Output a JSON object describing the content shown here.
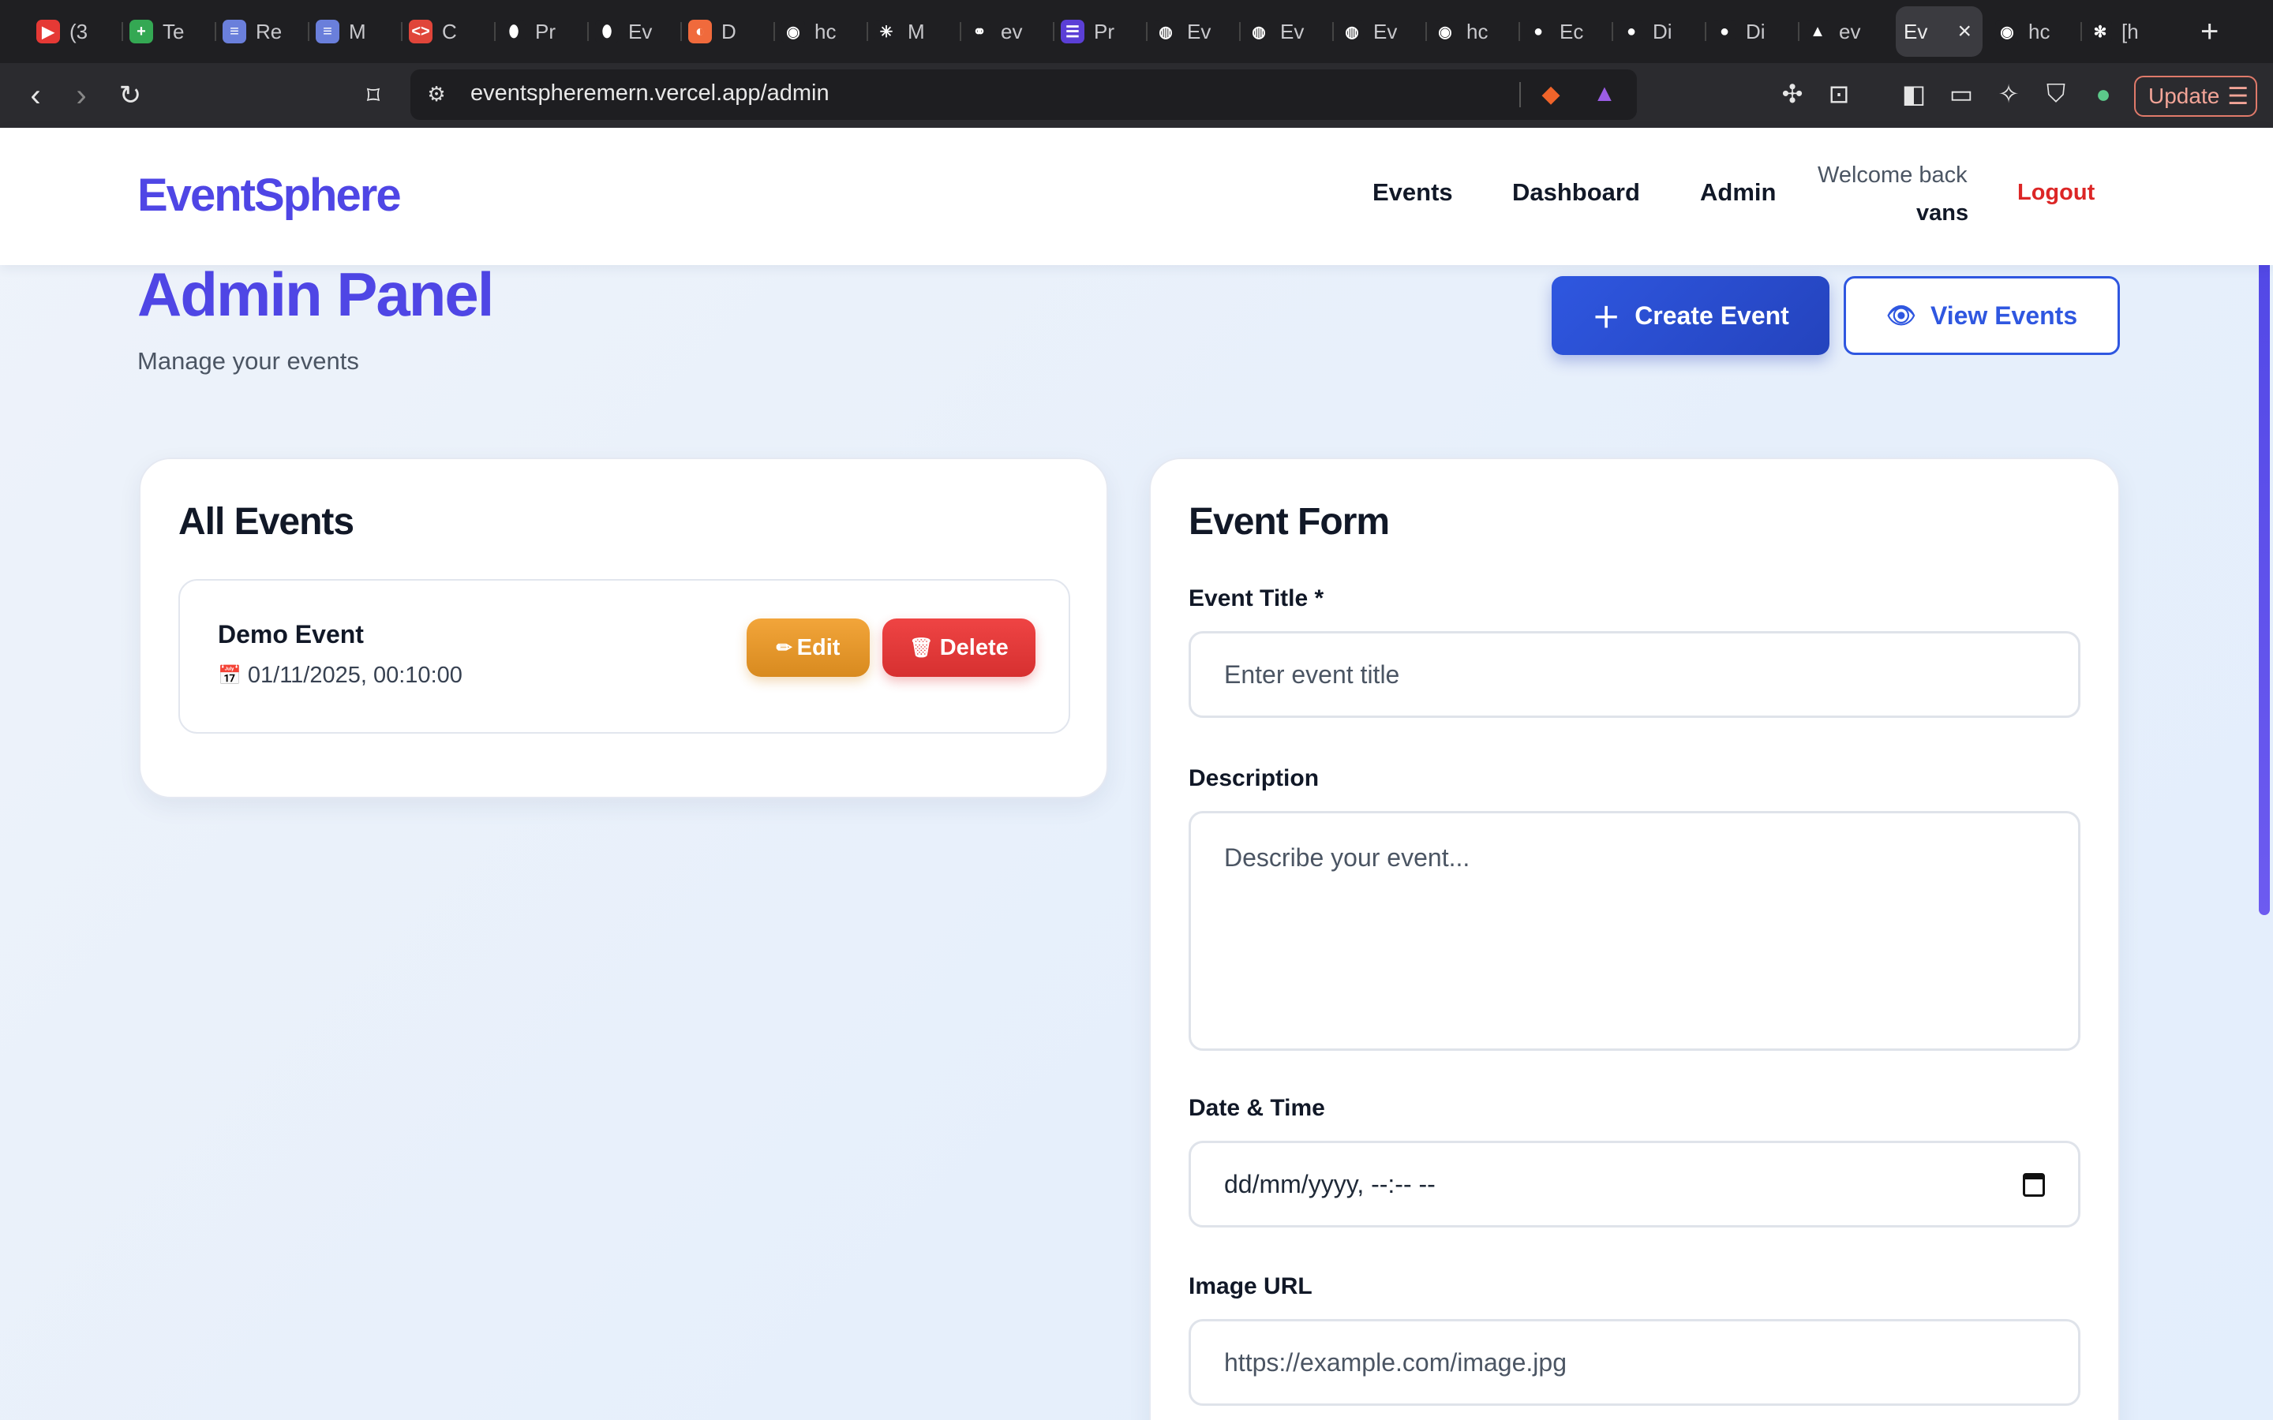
{
  "browser": {
    "tabs": [
      {
        "label": "(3",
        "favicon": "youtube-icon",
        "color": "#e53935",
        "glyph": "▶"
      },
      {
        "label": "Te",
        "favicon": "sheets-icon",
        "color": "#34a853",
        "glyph": "+"
      },
      {
        "label": "Re",
        "favicon": "doc-icon",
        "color": "#6a7fdb",
        "glyph": "≡"
      },
      {
        "label": "M",
        "favicon": "doc-icon",
        "color": "#6a7fdb",
        "glyph": "≡"
      },
      {
        "label": "C",
        "favicon": "code-icon",
        "color": "#e0453a",
        "glyph": "<>"
      },
      {
        "label": "Pr",
        "favicon": "mongodb-leaf-icon",
        "color": "#1f1f22",
        "glyph": "⬮"
      },
      {
        "label": "Ev",
        "favicon": "mongodb-leaf-icon",
        "color": "#1f1f22",
        "glyph": "⬮"
      },
      {
        "label": "D",
        "favicon": "app-icon",
        "color": "#f06a3c",
        "glyph": "◐"
      },
      {
        "label": "hc",
        "favicon": "brave-shield-icon",
        "color": "#1f1f22",
        "glyph": "◉"
      },
      {
        "label": "M",
        "favicon": "claude-icon",
        "color": "#1f1f22",
        "glyph": "✳"
      },
      {
        "label": "ev",
        "favicon": "link-icon",
        "color": "#1f1f22",
        "glyph": "⚭"
      },
      {
        "label": "Pr",
        "favicon": "list-icon",
        "color": "#5b3fd6",
        "glyph": "☰"
      },
      {
        "label": "Ev",
        "favicon": "globe-icon",
        "color": "#1f1f22",
        "glyph": "◍"
      },
      {
        "label": "Ev",
        "favicon": "globe-icon",
        "color": "#1f1f22",
        "glyph": "◍"
      },
      {
        "label": "Ev",
        "favicon": "globe-icon",
        "color": "#1f1f22",
        "glyph": "◍"
      },
      {
        "label": "hc",
        "favicon": "brave-shield-icon",
        "color": "#1f1f22",
        "glyph": "◉"
      },
      {
        "label": "Ec",
        "favicon": "github-icon",
        "color": "#1f1f22",
        "glyph": "●"
      },
      {
        "label": "Di",
        "favicon": "github-icon",
        "color": "#1f1f22",
        "glyph": "●"
      },
      {
        "label": "Di",
        "favicon": "github-icon",
        "color": "#1f1f22",
        "glyph": "●"
      },
      {
        "label": "ev",
        "favicon": "vercel-icon",
        "color": "#1f1f22",
        "glyph": "▲"
      },
      {
        "label": "Ev",
        "favicon": "",
        "color": "",
        "glyph": "",
        "active": true
      },
      {
        "label": "hc",
        "favicon": "brave-shield-icon",
        "color": "#1f1f22",
        "glyph": "◉"
      },
      {
        "label": "[h",
        "favicon": "bug-icon",
        "color": "#1f1f22",
        "glyph": "✻"
      }
    ],
    "url": "eventspheremern.vercel.app/admin",
    "update_label": "Update"
  },
  "header": {
    "logo": "EventSphere",
    "nav": [
      "Events",
      "Dashboard",
      "Admin"
    ],
    "welcome": "Welcome back",
    "username": "vans",
    "logout": "Logout"
  },
  "page": {
    "title": "Admin Panel",
    "subtitle": "Manage your events",
    "create_button": "Create Event",
    "view_button": "View Events"
  },
  "events_card": {
    "title": "All Events",
    "items": [
      {
        "name": "Demo Event",
        "date": "01/11/2025, 00:10:00",
        "edit": "Edit",
        "delete": "Delete"
      }
    ]
  },
  "form": {
    "title": "Event Form",
    "title_label": "Event Title *",
    "title_placeholder": "Enter event title",
    "description_label": "Description",
    "description_placeholder": "Describe your event...",
    "datetime_label": "Date & Time",
    "datetime_value": "dd/mm/yyyy, --:-- --",
    "image_label": "Image URL",
    "image_placeholder": "https://example.com/image.jpg"
  },
  "colors": {
    "brand": "#4f46e5",
    "primary_button": "#2f57e0",
    "edit": "#e59a2e",
    "delete": "#e03a3a",
    "logout": "#dc2626"
  }
}
